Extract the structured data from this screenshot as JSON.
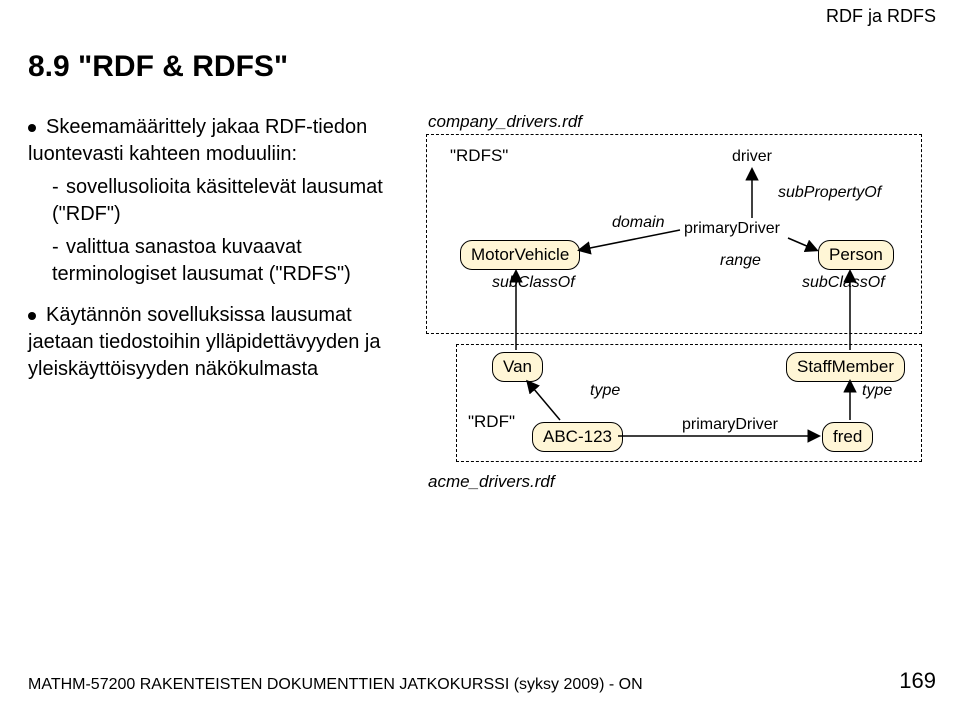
{
  "header": {
    "right": "RDF ja RDFS"
  },
  "title": "8.9 \"RDF & RDFS\"",
  "bullets": {
    "b1": "Skeemamäärittely jakaa RDF-tiedon luontevasti kahteen moduuliin:",
    "b1a": "sovellusolioita käsittelevät lausumat (\"RDF\")",
    "b1b": "valittua sanastoa kuvaavat terminologiset lausumat (\"RDFS\")",
    "b2": "Käytännön sovelluksissa lausumat jaetaan tiedostoihin ylläpidettävyyden ja yleiskäyttöisyyden näkökulmasta"
  },
  "diagram": {
    "file_top": "company_drivers.rdf",
    "file_bottom": "acme_drivers.rdf",
    "label_rdfs": "\"RDFS\"",
    "label_rdf": "\"RDF\"",
    "node_motor": "MotorVehicle",
    "node_van": "Van",
    "node_abc": "ABC-123",
    "node_person": "Person",
    "node_staff": "StaffMember",
    "node_fred": "fred",
    "txt_driver": "driver",
    "txt_subprop": "subPropertyOf",
    "txt_primary_top": "primaryDriver",
    "txt_primary_bot": "primaryDriver",
    "txt_domain": "domain",
    "txt_range": "range",
    "txt_subclass": "subClassOf",
    "txt_type": "type"
  },
  "footer": {
    "left": "MATHM-57200 RAKENTEISTEN DOKUMENTTIEN JATKOKURSSI (syksy 2009) - ON",
    "page": "169"
  },
  "chart_data": {
    "type": "diagram",
    "title": "RDF & RDFS schema split",
    "files": [
      {
        "name": "company_drivers.rdf",
        "section": "RDFS",
        "nodes": [
          "MotorVehicle",
          "Van",
          "driver",
          "primaryDriver",
          "Person",
          "StaffMember"
        ]
      },
      {
        "name": "acme_drivers.rdf",
        "section": "RDF",
        "nodes": [
          "ABC-123",
          "fred"
        ]
      }
    ],
    "edges": [
      {
        "from": "primaryDriver",
        "to": "driver",
        "label": "subPropertyOf"
      },
      {
        "from": "primaryDriver",
        "to": "MotorVehicle",
        "label": "domain"
      },
      {
        "from": "primaryDriver",
        "to": "Person",
        "label": "range"
      },
      {
        "from": "Van",
        "to": "MotorVehicle",
        "label": "subClassOf"
      },
      {
        "from": "StaffMember",
        "to": "Person",
        "label": "subClassOf"
      },
      {
        "from": "ABC-123",
        "to": "Van",
        "label": "type"
      },
      {
        "from": "fred",
        "to": "StaffMember",
        "label": "type"
      },
      {
        "from": "ABC-123",
        "to": "fred",
        "label": "primaryDriver"
      }
    ]
  }
}
